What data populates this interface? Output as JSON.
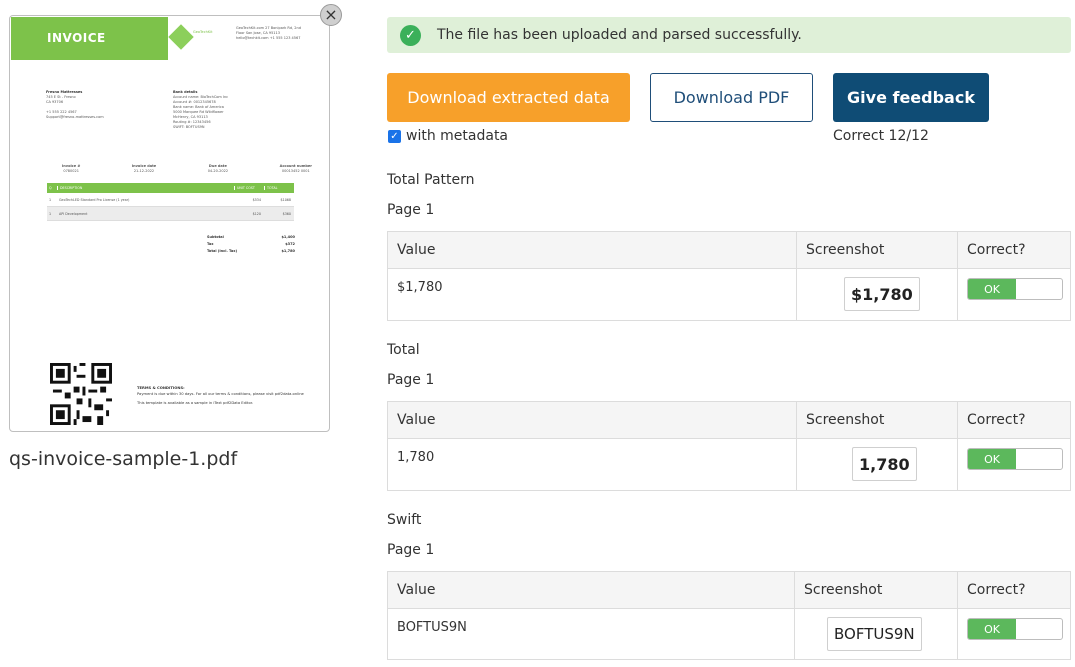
{
  "preview": {
    "filename": "qs-invoice-sample-1.pdf",
    "invoice": {
      "title": "INVOICE",
      "logo_text": "GeoTechKit",
      "company_address": "GeoTechKit.com 27 Bonipark Rd, 2nd Floor San Jose, CA 95113 hello@techkit.com +1 555 123 4567",
      "bill_to_title": "Fresno Mattresses",
      "bill_to_lines": [
        "745 E St - Fresno",
        "CA 93706",
        "",
        "+1 555 222 4567",
        "Support@fresno-mattresses.com"
      ],
      "bank_title": "Bank details",
      "bank_lines": [
        "Account name: BioTechCom Inc",
        "Account #: 0012345678",
        "Bank name: Bank of America",
        "5000 Marquee Rd Wildflower",
        "McHenry, CA 93113",
        "Routing #: 12343456",
        "SWIFT: BOFTUS9N"
      ],
      "meta": [
        {
          "label": "Invoice #",
          "value": "0780021"
        },
        {
          "label": "Invoice date",
          "value": "21-12-2022"
        },
        {
          "label": "Due date",
          "value": "04-20-2022"
        },
        {
          "label": "Account number",
          "value": "00013452 0001"
        }
      ],
      "table_headers": [
        "Q",
        "DESCRIPTION",
        "UNIT COST",
        "TOTAL"
      ],
      "rows": [
        {
          "q": "1",
          "desc": "GeoTechLED Standard Pro License (1 year)",
          "unit": "$534",
          "total": "$1068"
        },
        {
          "q": "1",
          "desc": "API Development",
          "unit": "$120",
          "total": "$360"
        }
      ],
      "totals": [
        {
          "label": "Subtotal",
          "value": "$1,400"
        },
        {
          "label": "Tax",
          "value": "$372"
        },
        {
          "label": "Total (Incl. Tax)",
          "value": "$1,780"
        }
      ],
      "terms_title": "TERMS & CONDITIONS:",
      "terms_body": "Payment is due within 30 days. For all our terms & conditions, please visit pdf2data.online",
      "terms_footer": "This template is available as a sample in iText pdf2Data Editor."
    }
  },
  "alert": {
    "text": "The file has been uploaded and parsed successfully."
  },
  "actions": {
    "download_extracted": "Download extracted data",
    "download_pdf": "Download PDF",
    "give_feedback": "Give feedback",
    "with_metadata": "with metadata",
    "correct_count": "Correct 12/12"
  },
  "columns": {
    "value": "Value",
    "screenshot": "Screenshot",
    "correct": "Correct?"
  },
  "fields": [
    {
      "name": "Total Pattern",
      "page": "Page 1",
      "value": "$1,780",
      "screenshot": "$1,780",
      "status": "OK"
    },
    {
      "name": "Total",
      "page": "Page 1",
      "value": "1,780",
      "screenshot": "1,780",
      "status": "OK"
    },
    {
      "name": "Swift",
      "page": "Page 1",
      "value": "BOFTUS9N",
      "screenshot": "BOFTUS9N",
      "status": "OK"
    }
  ],
  "colors": {
    "accent_orange": "#f7a02a",
    "navy": "#0f4c75",
    "success_bg": "#dff0d8",
    "ok_green": "#5cb85c",
    "invoice_green": "#7dc24a"
  }
}
